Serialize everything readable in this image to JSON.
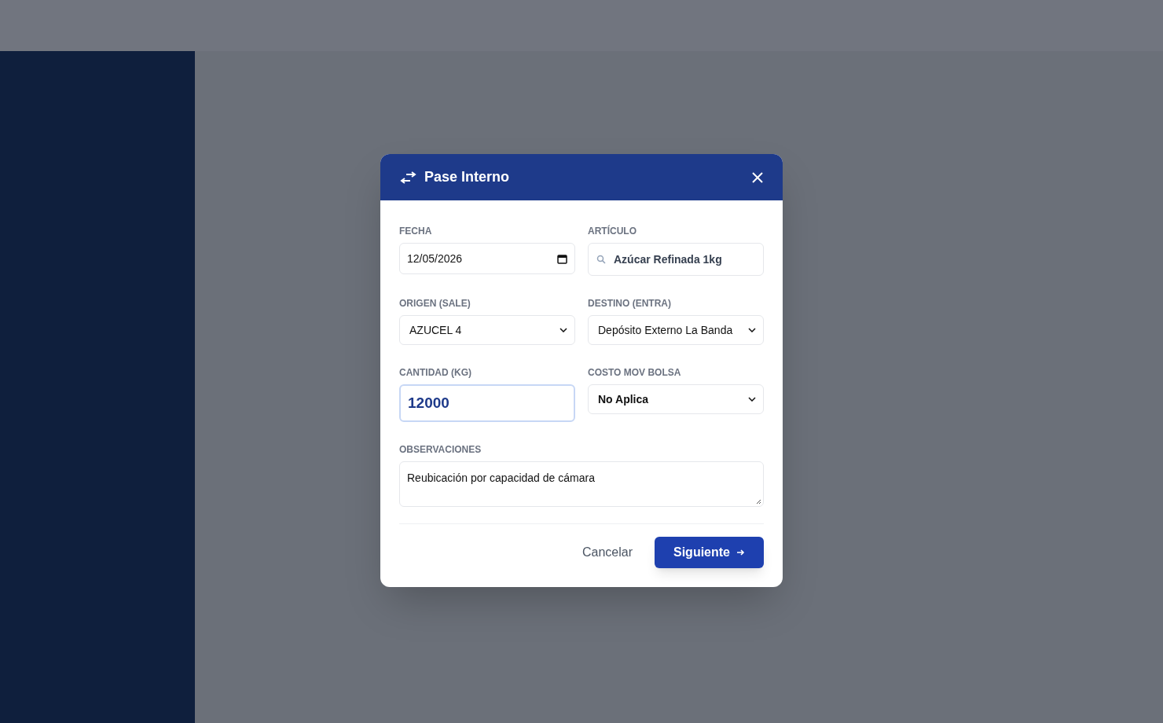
{
  "dialog": {
    "title": "Pase Interno",
    "fields": [
      {
        "label": "FECHA",
        "kind": "date",
        "value": "12/05/2026",
        "focused": false
      },
      {
        "label": "ARTÍCULO",
        "kind": "search",
        "value": "Azúcar Refinada 1kg",
        "focused": false
      },
      {
        "label": "ORIGEN (SALE)",
        "kind": "select",
        "value": "AZUCEL 4",
        "focused": false
      },
      {
        "label": "DESTINO (ENTRA)",
        "kind": "select",
        "value": "Depósito Externo La Banda",
        "focused": false
      },
      {
        "label": "CANTIDAD (KG)",
        "kind": "number",
        "value": "12000",
        "focused": true
      },
      {
        "label": "COSTO MOV BOLSA",
        "kind": "select_bold",
        "value": "No Aplica",
        "focused": false
      },
      {
        "label": "OBSERVACIONES",
        "kind": "textarea",
        "value": "Reubicación por capacidad de cámara",
        "focused": false
      }
    ],
    "buttons": [
      {
        "label": "Cancelar",
        "kind": "secondary"
      },
      {
        "label": "Siguiente",
        "kind": "primary"
      }
    ]
  }
}
